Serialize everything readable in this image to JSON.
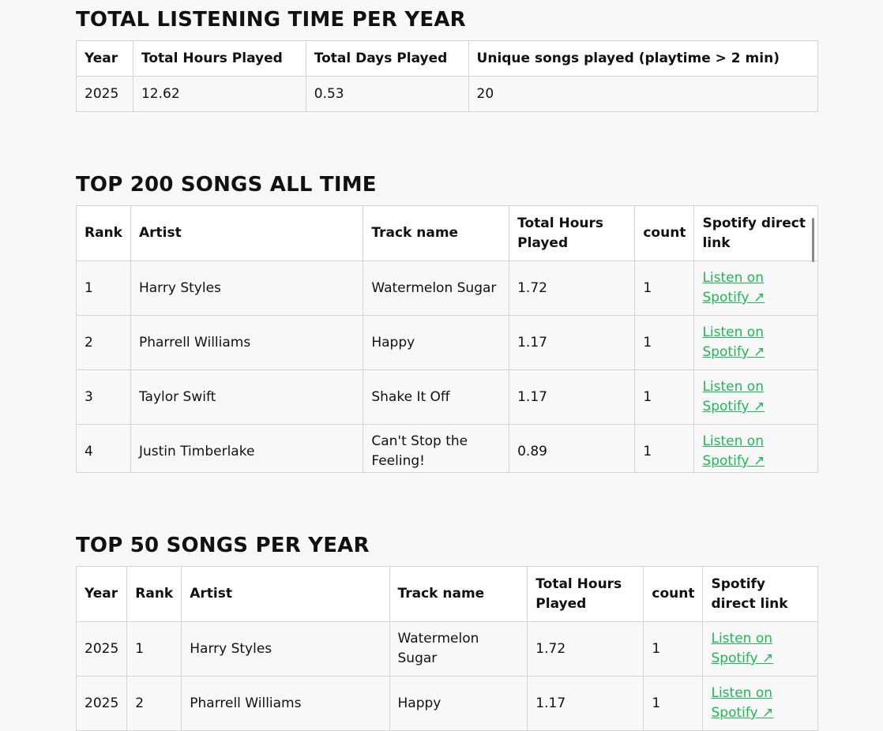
{
  "year_section": {
    "title": "TOTAL LISTENING TIME PER YEAR",
    "headers": [
      "Year",
      "Total Hours Played",
      "Total Days Played",
      "Unique songs played (playtime > 2 min)"
    ],
    "rows": [
      [
        "2025",
        "12.62",
        "0.53",
        "20"
      ]
    ]
  },
  "top200": {
    "title": "TOP 200 SONGS ALL TIME",
    "headers": [
      "Rank",
      "Artist",
      "Track name",
      "Total Hours Played",
      "count",
      "Spotify direct link"
    ],
    "rows": [
      [
        "1",
        "Harry Styles",
        "Watermelon Sugar",
        "1.72",
        "1",
        "Listen on Spotify ↗"
      ],
      [
        "2",
        "Pharrell Williams",
        "Happy",
        "1.17",
        "1",
        "Listen on Spotify ↗"
      ],
      [
        "3",
        "Taylor Swift",
        "Shake It Off",
        "1.17",
        "1",
        "Listen on Spotify ↗"
      ],
      [
        "4",
        "Justin Timberlake",
        "Can't Stop the Feeling!",
        "0.89",
        "1",
        "Listen on Spotify ↗"
      ]
    ]
  },
  "top50": {
    "title": "TOP 50 SONGS PER YEAR",
    "headers": [
      "Year",
      "Rank",
      "Artist",
      "Track name",
      "Total Hours Played",
      "count",
      "Spotify direct link"
    ],
    "rows": [
      [
        "2025",
        "1",
        "Harry Styles",
        "Watermelon Sugar",
        "1.72",
        "1",
        "Listen on Spotify ↗"
      ],
      [
        "2025",
        "2",
        "Pharrell Williams",
        "Happy",
        "1.17",
        "1",
        "Listen on Spotify ↗"
      ]
    ]
  },
  "colors": {
    "link": "#1db954",
    "background": "#f8f8f8",
    "header_bg": "#ffffff",
    "border": "#d4d4d4"
  }
}
